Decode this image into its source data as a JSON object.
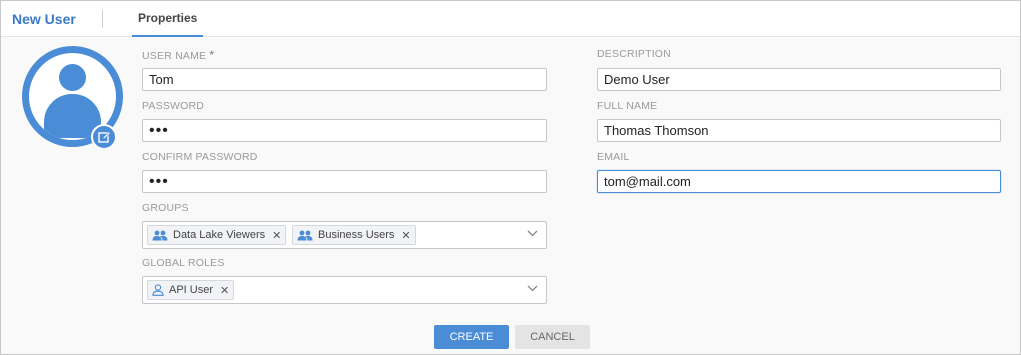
{
  "header": {
    "title": "New User",
    "tab": "Properties"
  },
  "form": {
    "username": {
      "label": "USER NAME",
      "required_mark": "*",
      "value": "Tom"
    },
    "password": {
      "label": "PASSWORD",
      "value": "•••"
    },
    "confirm_password": {
      "label": "CONFIRM PASSWORD",
      "value": "•••"
    },
    "groups": {
      "label": "GROUPS",
      "chips": [
        {
          "label": "Data Lake Viewers",
          "icon": "group-icon"
        },
        {
          "label": "Business Users",
          "icon": "group-icon"
        }
      ]
    },
    "global_roles": {
      "label": "GLOBAL ROLES",
      "chips": [
        {
          "label": "API User",
          "icon": "user-icon"
        }
      ]
    },
    "description": {
      "label": "DESCRIPTION",
      "value": "Demo User"
    },
    "full_name": {
      "label": "FULL NAME",
      "value": "Thomas Thomson"
    },
    "email": {
      "label": "EMAIL",
      "value": "tom@mail.com"
    }
  },
  "actions": {
    "create": "CREATE",
    "cancel": "CANCEL"
  },
  "colors": {
    "accent": "#4a8cd6",
    "title": "#3a7bc8"
  }
}
